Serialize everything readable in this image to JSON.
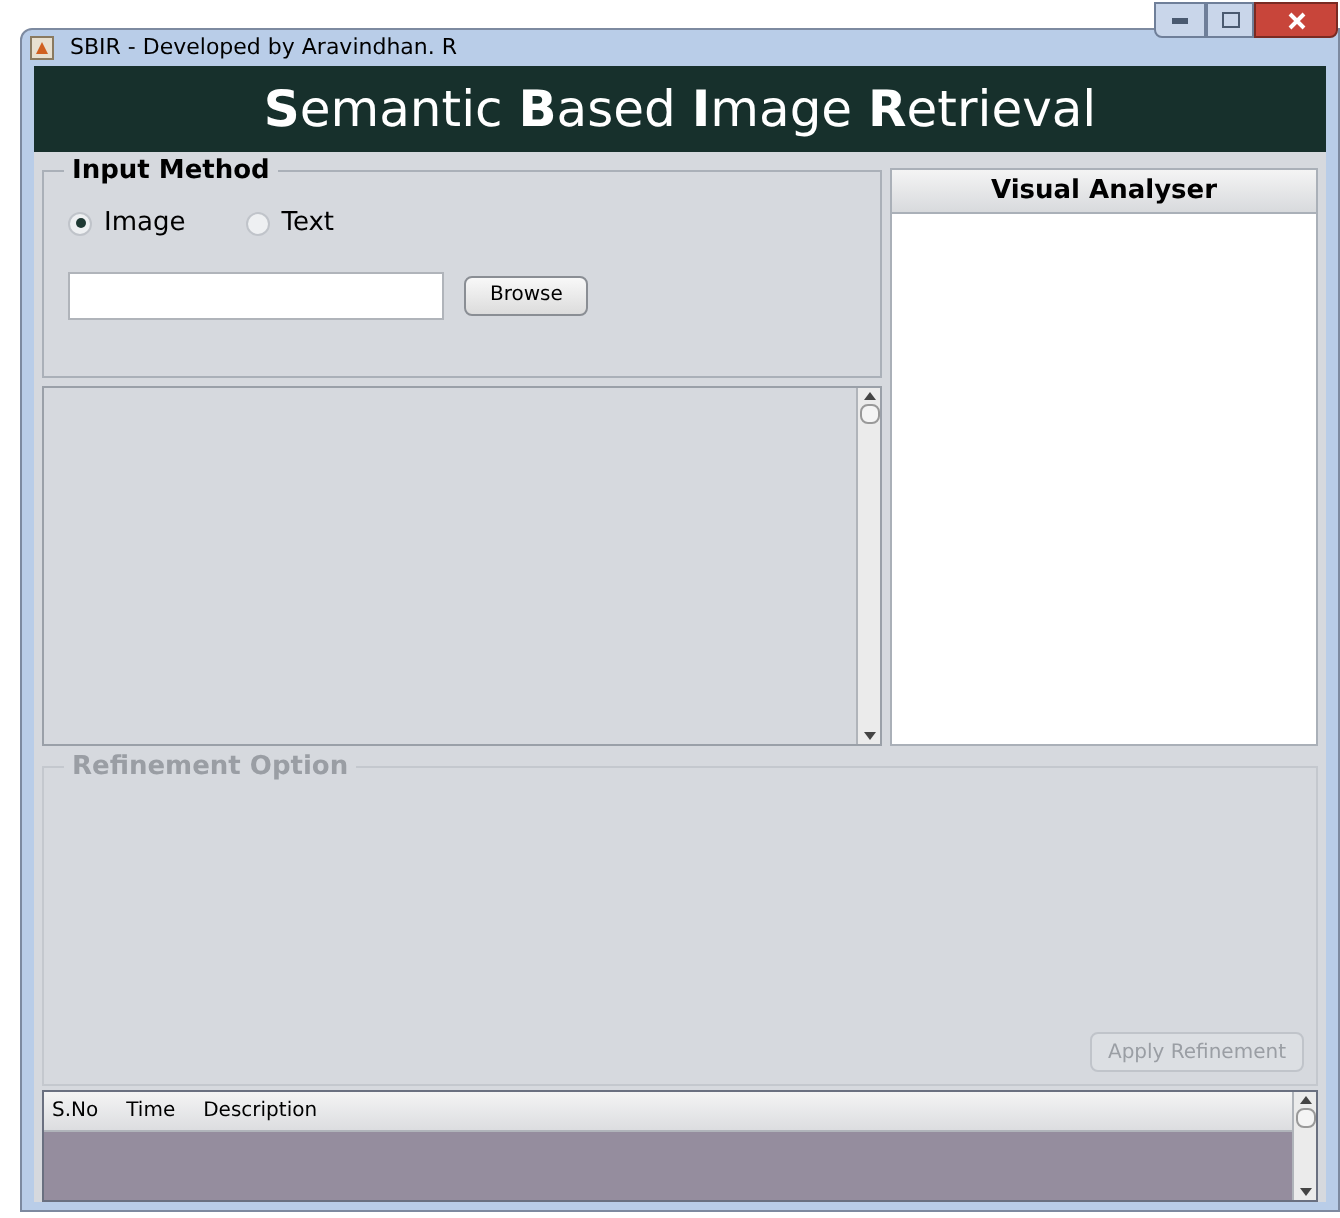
{
  "window": {
    "title": "SBIR - Developed by Aravindhan. R"
  },
  "banner": "**S**emantic **B**ased **I**mage **R**etrieval",
  "input_method": {
    "legend": "Input Method",
    "options": [
      {
        "label": "Image",
        "selected": true
      },
      {
        "label": "Text",
        "selected": false
      }
    ],
    "browse": "Browse"
  },
  "visual_analyser": {
    "title": "Visual Analyser"
  },
  "refinement": {
    "legend": "Refinement Option",
    "disabled": true,
    "button": "Apply Refinement"
  },
  "table": {
    "columns": [
      "S.No",
      "Time",
      "Description"
    ]
  }
}
